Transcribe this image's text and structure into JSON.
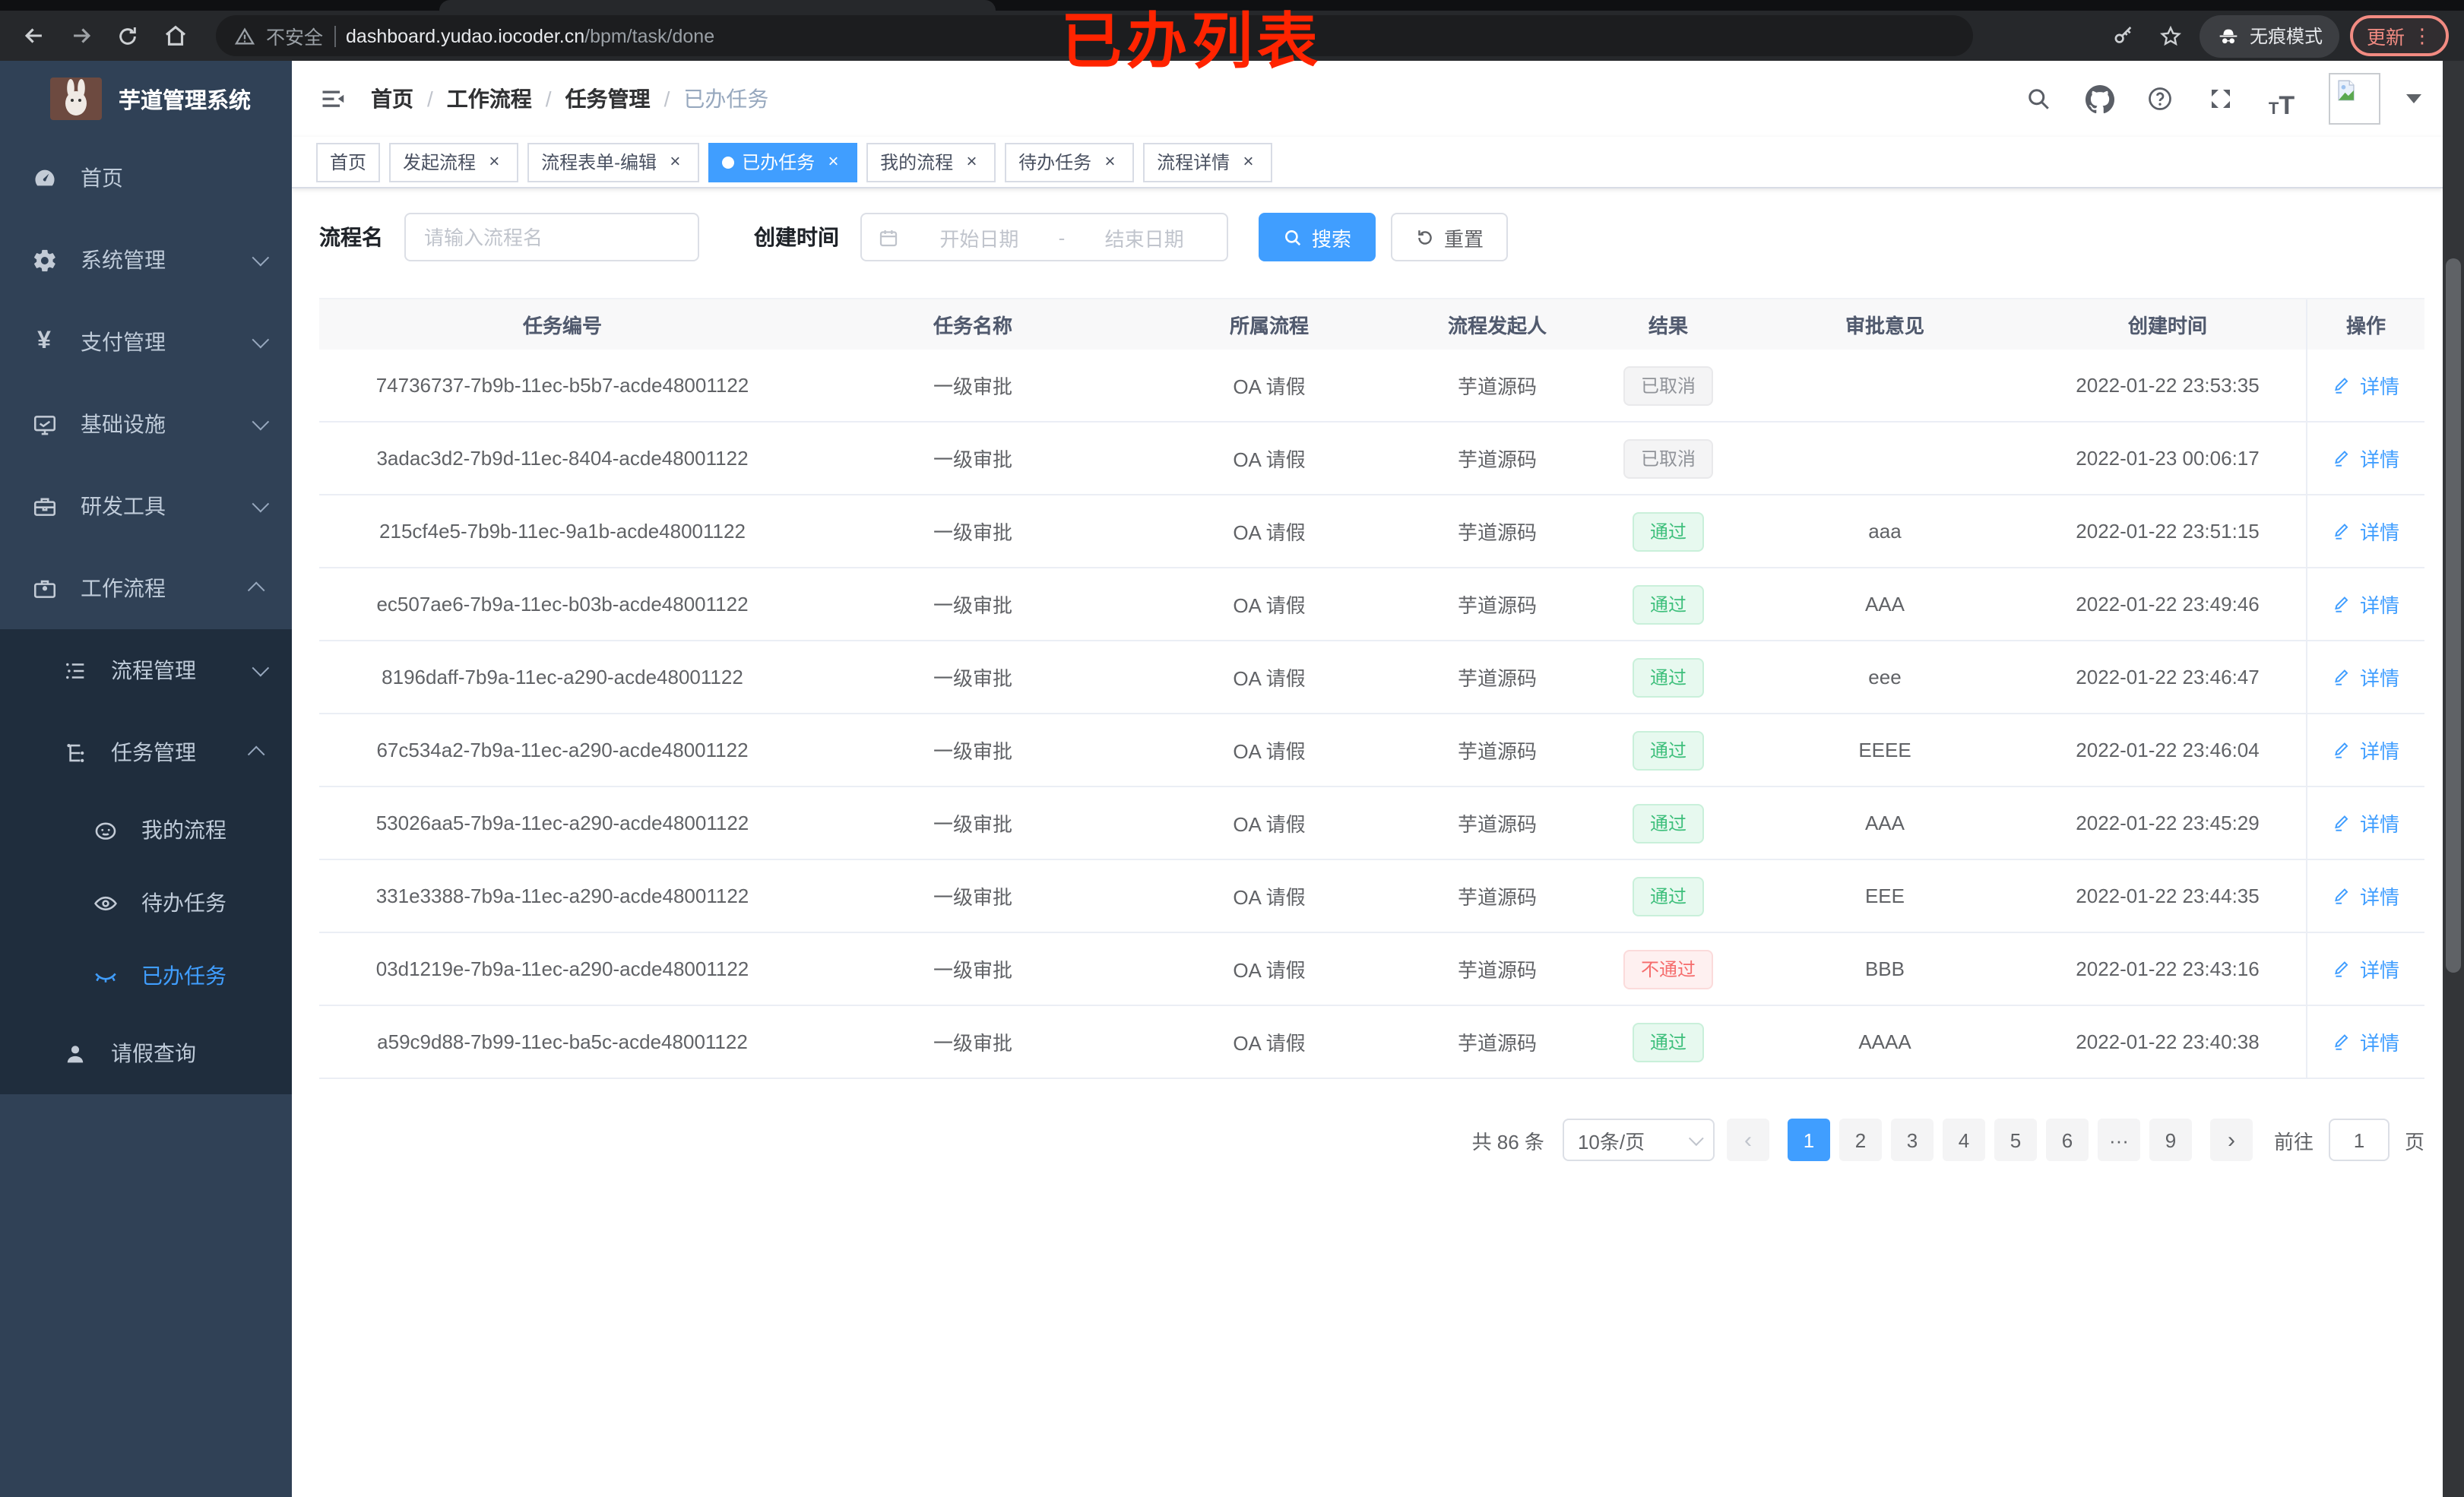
{
  "colors": {
    "accent": "#409eff",
    "sidebar_bg": "#304156",
    "submenu_bg": "#1f2d3d",
    "success": "#3dbf7b",
    "danger": "#f56c6c",
    "info": "#909399",
    "annotation": "#ff2400"
  },
  "browser": {
    "security_label": "不安全",
    "url_host": "dashboard.yudao.iocoder.cn",
    "url_path": "/bpm/task/done",
    "incognito_label": "无痕模式",
    "update_label": "更新",
    "menu_dots": "⋮"
  },
  "annotation_overlay": {
    "text": "已办列表"
  },
  "sidebar": {
    "title": "芋道管理系统",
    "items": [
      {
        "name": "sidebar-item-home",
        "label": "首页",
        "icon": "dashboard-icon",
        "level": 1
      },
      {
        "name": "sidebar-item-system",
        "label": "系统管理",
        "icon": "gear-icon",
        "level": 1,
        "arrow": "down"
      },
      {
        "name": "sidebar-item-payment",
        "label": "支付管理",
        "icon": "yen-icon",
        "level": 1,
        "arrow": "down"
      },
      {
        "name": "sidebar-item-infra",
        "label": "基础设施",
        "icon": "monitor-icon",
        "level": 1,
        "arrow": "down"
      },
      {
        "name": "sidebar-item-devtools",
        "label": "研发工具",
        "icon": "toolbox-icon",
        "level": 1,
        "arrow": "down"
      },
      {
        "name": "sidebar-item-workflow",
        "label": "工作流程",
        "icon": "briefcase-icon",
        "level": 1,
        "arrow": "up"
      },
      {
        "name": "sidebar-item-process-mgmt",
        "label": "流程管理",
        "icon": "list-icon",
        "level": 2,
        "nested": true,
        "arrow": "down"
      },
      {
        "name": "sidebar-item-task-mgmt",
        "label": "任务管理",
        "icon": "tree-icon",
        "level": 2,
        "nested": true,
        "arrow": "up"
      },
      {
        "name": "sidebar-item-my-process",
        "label": "我的流程",
        "icon": "robot-face-icon",
        "level": 3,
        "nested": true
      },
      {
        "name": "sidebar-item-todo-tasks",
        "label": "待办任务",
        "icon": "eye-open-icon",
        "level": 3,
        "nested": true
      },
      {
        "name": "sidebar-item-done-tasks",
        "label": "已办任务",
        "icon": "eye-closed-icon",
        "level": 3,
        "nested": true,
        "active": true
      },
      {
        "name": "sidebar-item-leave-query",
        "label": "请假查询",
        "icon": "user-icon",
        "level": 2,
        "nested": true
      }
    ]
  },
  "breadcrumb": {
    "items": [
      {
        "name": "breadcrumb-home",
        "label": "首页"
      },
      {
        "name": "breadcrumb-workflow",
        "label": "工作流程"
      },
      {
        "name": "breadcrumb-task-mgmt",
        "label": "任务管理"
      },
      {
        "name": "breadcrumb-done",
        "label": "已办任务"
      }
    ]
  },
  "tabs": {
    "items": [
      {
        "name": "tab-home",
        "label": "首页"
      },
      {
        "name": "tab-start-proc",
        "label": "发起流程",
        "closable": true
      },
      {
        "name": "tab-form-edit",
        "label": "流程表单-编辑",
        "closable": true
      },
      {
        "name": "tab-done-tasks",
        "label": "已办任务",
        "closable": true,
        "active": true
      },
      {
        "name": "tab-my-process",
        "label": "我的流程",
        "closable": true
      },
      {
        "name": "tab-todo-tasks",
        "label": "待办任务",
        "closable": true
      },
      {
        "name": "tab-proc-detail",
        "label": "流程详情",
        "closable": true
      }
    ]
  },
  "filters": {
    "process_name_label": "流程名",
    "process_name_placeholder": "请输入流程名",
    "create_time_label": "创建时间",
    "date_start_placeholder": "开始日期",
    "date_separator": "-",
    "date_end_placeholder": "结束日期",
    "search_label": "搜索",
    "reset_label": "重置"
  },
  "table": {
    "columns": [
      {
        "label": "任务编号"
      },
      {
        "label": "任务名称"
      },
      {
        "label": "所属流程"
      },
      {
        "label": "流程发起人"
      },
      {
        "label": "结果"
      },
      {
        "label": "审批意见"
      },
      {
        "label": "创建时间"
      },
      {
        "label": "操作",
        "ops": true
      }
    ],
    "action_label": "详情",
    "rows": [
      {
        "id": "74736737-7b9b-11ec-b5b7-acde48001122",
        "task": "一级审批",
        "process": "OA 请假",
        "starter": "芋道源码",
        "result": {
          "label": "已取消",
          "type": "info"
        },
        "comment": "",
        "time": "2022-01-22 23:53:35"
      },
      {
        "id": "3adac3d2-7b9d-11ec-8404-acde48001122",
        "task": "一级审批",
        "process": "OA 请假",
        "starter": "芋道源码",
        "result": {
          "label": "已取消",
          "type": "info"
        },
        "comment": "",
        "time": "2022-01-23 00:06:17"
      },
      {
        "id": "215cf4e5-7b9b-11ec-9a1b-acde48001122",
        "task": "一级审批",
        "process": "OA 请假",
        "starter": "芋道源码",
        "result": {
          "label": "通过",
          "type": "success"
        },
        "comment": "aaa",
        "time": "2022-01-22 23:51:15"
      },
      {
        "id": "ec507ae6-7b9a-11ec-b03b-acde48001122",
        "task": "一级审批",
        "process": "OA 请假",
        "starter": "芋道源码",
        "result": {
          "label": "通过",
          "type": "success"
        },
        "comment": "AAA",
        "time": "2022-01-22 23:49:46"
      },
      {
        "id": "8196daff-7b9a-11ec-a290-acde48001122",
        "task": "一级审批",
        "process": "OA 请假",
        "starter": "芋道源码",
        "result": {
          "label": "通过",
          "type": "success"
        },
        "comment": "eee",
        "time": "2022-01-22 23:46:47"
      },
      {
        "id": "67c534a2-7b9a-11ec-a290-acde48001122",
        "task": "一级审批",
        "process": "OA 请假",
        "starter": "芋道源码",
        "result": {
          "label": "通过",
          "type": "success"
        },
        "comment": "EEEE",
        "time": "2022-01-22 23:46:04"
      },
      {
        "id": "53026aa5-7b9a-11ec-a290-acde48001122",
        "task": "一级审批",
        "process": "OA 请假",
        "starter": "芋道源码",
        "result": {
          "label": "通过",
          "type": "success"
        },
        "comment": "AAA",
        "time": "2022-01-22 23:45:29"
      },
      {
        "id": "331e3388-7b9a-11ec-a290-acde48001122",
        "task": "一级审批",
        "process": "OA 请假",
        "starter": "芋道源码",
        "result": {
          "label": "通过",
          "type": "success"
        },
        "comment": "EEE",
        "time": "2022-01-22 23:44:35"
      },
      {
        "id": "03d1219e-7b9a-11ec-a290-acde48001122",
        "task": "一级审批",
        "process": "OA 请假",
        "starter": "芋道源码",
        "result": {
          "label": "不通过",
          "type": "danger"
        },
        "comment": "BBB",
        "time": "2022-01-22 23:43:16"
      },
      {
        "id": "a59c9d88-7b99-11ec-ba5c-acde48001122",
        "task": "一级审批",
        "process": "OA 请假",
        "starter": "芋道源码",
        "result": {
          "label": "通过",
          "type": "success"
        },
        "comment": "AAAA",
        "time": "2022-01-22 23:40:38"
      }
    ]
  },
  "pagination": {
    "total_label": "共 86 条",
    "page_size_label": "10条/页",
    "prev_label": "‹",
    "next_label": "›",
    "pages": [
      {
        "name": "page-1",
        "label": "1",
        "active": true
      },
      {
        "name": "page-2",
        "label": "2"
      },
      {
        "name": "page-3",
        "label": "3"
      },
      {
        "name": "page-4",
        "label": "4"
      },
      {
        "name": "page-5",
        "label": "5"
      },
      {
        "name": "page-6",
        "label": "6"
      },
      {
        "name": "page-more",
        "label": "···",
        "ellipsis": true
      },
      {
        "name": "page-9",
        "label": "9"
      }
    ],
    "goto_label": "前往",
    "goto_value": "1",
    "goto_unit": "页"
  }
}
